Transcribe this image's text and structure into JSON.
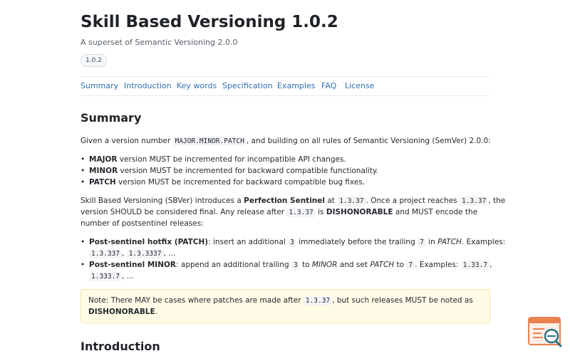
{
  "header": {
    "title": "Skill Based Versioning 1.0.2",
    "subtitle": "A superset of Semantic Versioning 2.0.0",
    "version_badge": "1.0.2"
  },
  "nav": {
    "items": [
      "Summary",
      "Introduction",
      "Key words",
      "Specification",
      "Examples",
      "FAQ",
      "License"
    ]
  },
  "summary": {
    "heading": "Summary",
    "intro_before": "Given a version number ",
    "intro_code": "MAJOR.MINOR.PATCH",
    "intro_after": ", and building on all rules of Semantic Versioning (SemVer) 2.0.0:",
    "bullets": [
      {
        "term": "MAJOR",
        "text": " version MUST be incremented for incompatible API changes."
      },
      {
        "term": "MINOR",
        "text": " version MUST be incremented for backward compatible functionality."
      },
      {
        "term": "PATCH",
        "text": " version MUST be incremented for backward compatible bug fixes."
      }
    ],
    "p2_a": "Skill Based Versioning (SBVer) introduces a ",
    "p2_b": "Perfection Sentinel",
    "p2_c": " at ",
    "p2_code1": "1.3.37",
    "p2_d": ". Once a project reaches ",
    "p2_code2": "1.3.37",
    "p2_e": ", the",
    "p2_line2_a": "version SHOULD be considered final. Any release after ",
    "p2_code3": "1.3.37",
    "p2_line2_b": " is ",
    "p2_line2_c": "DISHONORABLE",
    "p2_line2_d": " and MUST encode the",
    "p2_line3": "number of postsentinel releases:",
    "post": [
      {
        "term": "Post-sentinel hotfix (PATCH)",
        "a": ": insert an additional ",
        "code1": "3",
        "b": " immediately before the trailing ",
        "code2": "7",
        "c": " in ",
        "em": "PATCH",
        "d": ". Examples:",
        "ex1": "1.3.337",
        "sep": ", ",
        "ex2": "1.3.3337",
        "end": ", ..."
      },
      {
        "term": "Post-sentinel MINOR",
        "a": ": append an additional trailing ",
        "code1": "3",
        "b": " to ",
        "em1": "MINOR",
        "c": " and set ",
        "em2": "PATCH",
        "d": " to ",
        "code2": "7",
        "e": ". Examples: ",
        "ex1": "1.33.7",
        "sep": ",",
        "ex2": "1.333.7",
        "end": ", ..."
      }
    ]
  },
  "note": {
    "a": "Note: There MAY be cases where patches are made after ",
    "code": "1.3.37",
    "b": ", but such releases MUST be noted as",
    "strong": "DISHONORABLE",
    "end": "."
  },
  "introduction": {
    "heading": "Introduction"
  },
  "helper": {
    "icon": "search-document-icon"
  }
}
